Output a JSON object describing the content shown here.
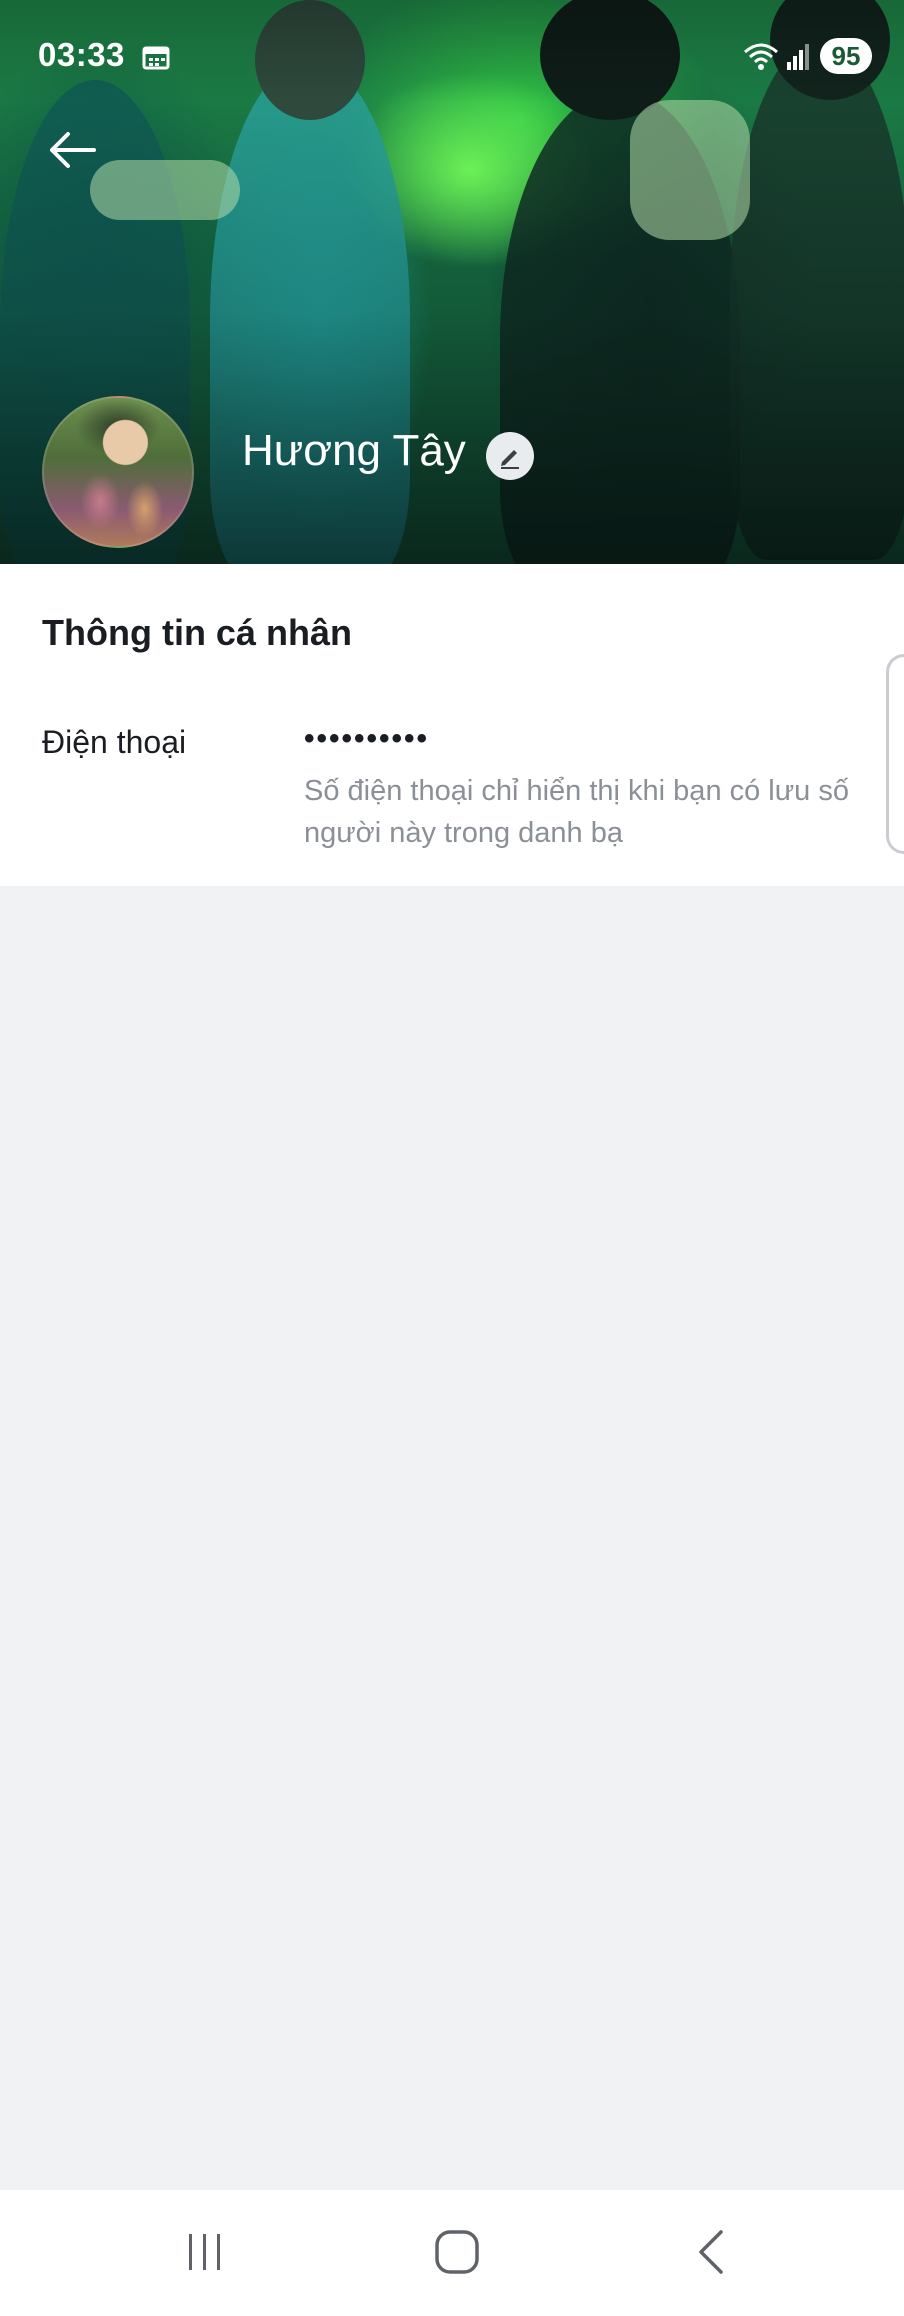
{
  "status_bar": {
    "time": "03:33",
    "battery": "95",
    "icons": [
      "calendar-icon",
      "wifi-icon",
      "signal-icon",
      "battery-icon"
    ]
  },
  "header": {
    "back_icon": "arrow-left-icon",
    "profile_name": "Hương Tây",
    "edit_icon": "pencil-icon"
  },
  "personal_info": {
    "title": "Thông tin cá nhân",
    "phone": {
      "label": "Điện thoại",
      "value": "••••••••••",
      "note": "Số điện thoại chỉ hiển thị khi bạn có lưu số người này trong danh bạ"
    }
  },
  "navigation": {
    "recent_apps_icon": "recent-apps-icon",
    "home_icon": "home-icon",
    "back_icon": "back-icon"
  },
  "colors": {
    "page_background": "#f1f2f4",
    "card_background": "#ffffff",
    "primary_text": "#1a1d21",
    "secondary_text": "#8a9096",
    "status_accent": "#1b5a37"
  }
}
